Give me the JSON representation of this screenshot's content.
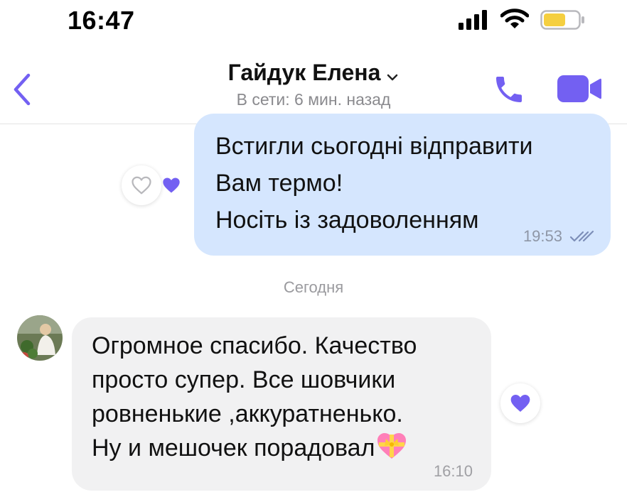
{
  "status_bar": {
    "time": "16:47"
  },
  "header": {
    "contact_name": "Гайдук Елена",
    "contact_status": "В сети: 6 мин. назад"
  },
  "messages": {
    "outgoing": {
      "lines": [
        "Встигли сьогодні відправити",
        "Вам термо!",
        "Носіть із задоволенням"
      ],
      "time": "19:53"
    },
    "date_separator": "Сегодня",
    "incoming": {
      "lines": [
        "Огромное спасибо. Качество",
        "просто супер. Все шовчики",
        "ровненькие ,аккуратненько.",
        "Ну и мешочек порадовал"
      ],
      "time": "16:10"
    }
  },
  "icons": {
    "back": "chevron-left-icon",
    "call": "phone-icon",
    "video": "video-camera-icon",
    "read_receipt": "double-check-icon",
    "reaction": "heart-icon",
    "emoji": "heart-with-ribbon-emoji"
  },
  "colors": {
    "accent": "#7360f2",
    "outgoing_bubble": "#d5e6fe",
    "incoming_bubble": "#f1f1f2",
    "secondary_text": "#8a8a8e"
  }
}
